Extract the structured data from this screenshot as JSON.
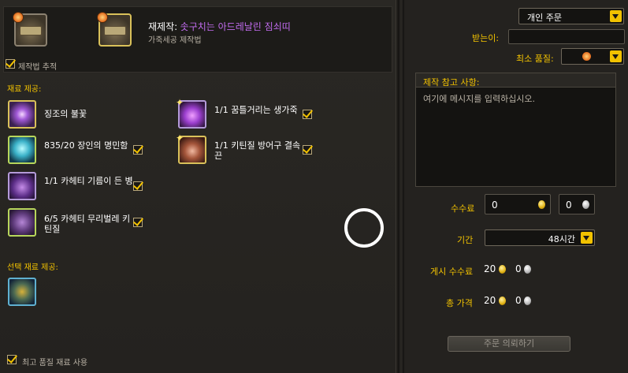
{
  "recipe": {
    "prefix": "재제작:",
    "name": "솟구치는 아드레날린 짐쇠띠",
    "subtitle": "가죽세공 제작법",
    "track_label": "제작법 추적"
  },
  "sections": {
    "provided_materials": "재료 제공:",
    "optional_materials": "선택 재료 제공:",
    "use_best_quality": "최고 품질 재료 사용"
  },
  "materials_left": [
    {
      "name": "징조의 불꽃",
      "checked": false
    },
    {
      "name": "835/20 장인의 명민함",
      "checked": true
    },
    {
      "name": "1/1 카헤티 기름이 든 병",
      "checked": true
    },
    {
      "name": "6/5 카헤티 무리벌레 키틴질",
      "checked": true
    }
  ],
  "materials_right": [
    {
      "name": "1/1 꿈틀거리는 생가죽",
      "checked": true
    },
    {
      "name": "1/1 키틴질 방어구 결속끈",
      "checked": true
    }
  ],
  "order": {
    "type_selected": "개인 주문",
    "recipient_label": "받는이:",
    "recipient_value": "",
    "min_quality_label": "최소 품질:",
    "notes_label": "제작 참고 사항:",
    "notes_placeholder": "여기에 메시지를 입력하십시오.",
    "commission_label": "수수료",
    "commission_gold": "0",
    "commission_silver": "0",
    "duration_label": "기간",
    "duration_value": "48시간",
    "posting_fee_label": "게시 수수료",
    "posting_fee_gold": "20",
    "posting_fee_silver": "0",
    "total_label": "총 가격",
    "total_gold": "20",
    "total_silver": "0",
    "submit_label": "주문 의뢰하기"
  },
  "colors": {
    "accent": "#f2c200",
    "epic_name": "#c26cf0"
  }
}
